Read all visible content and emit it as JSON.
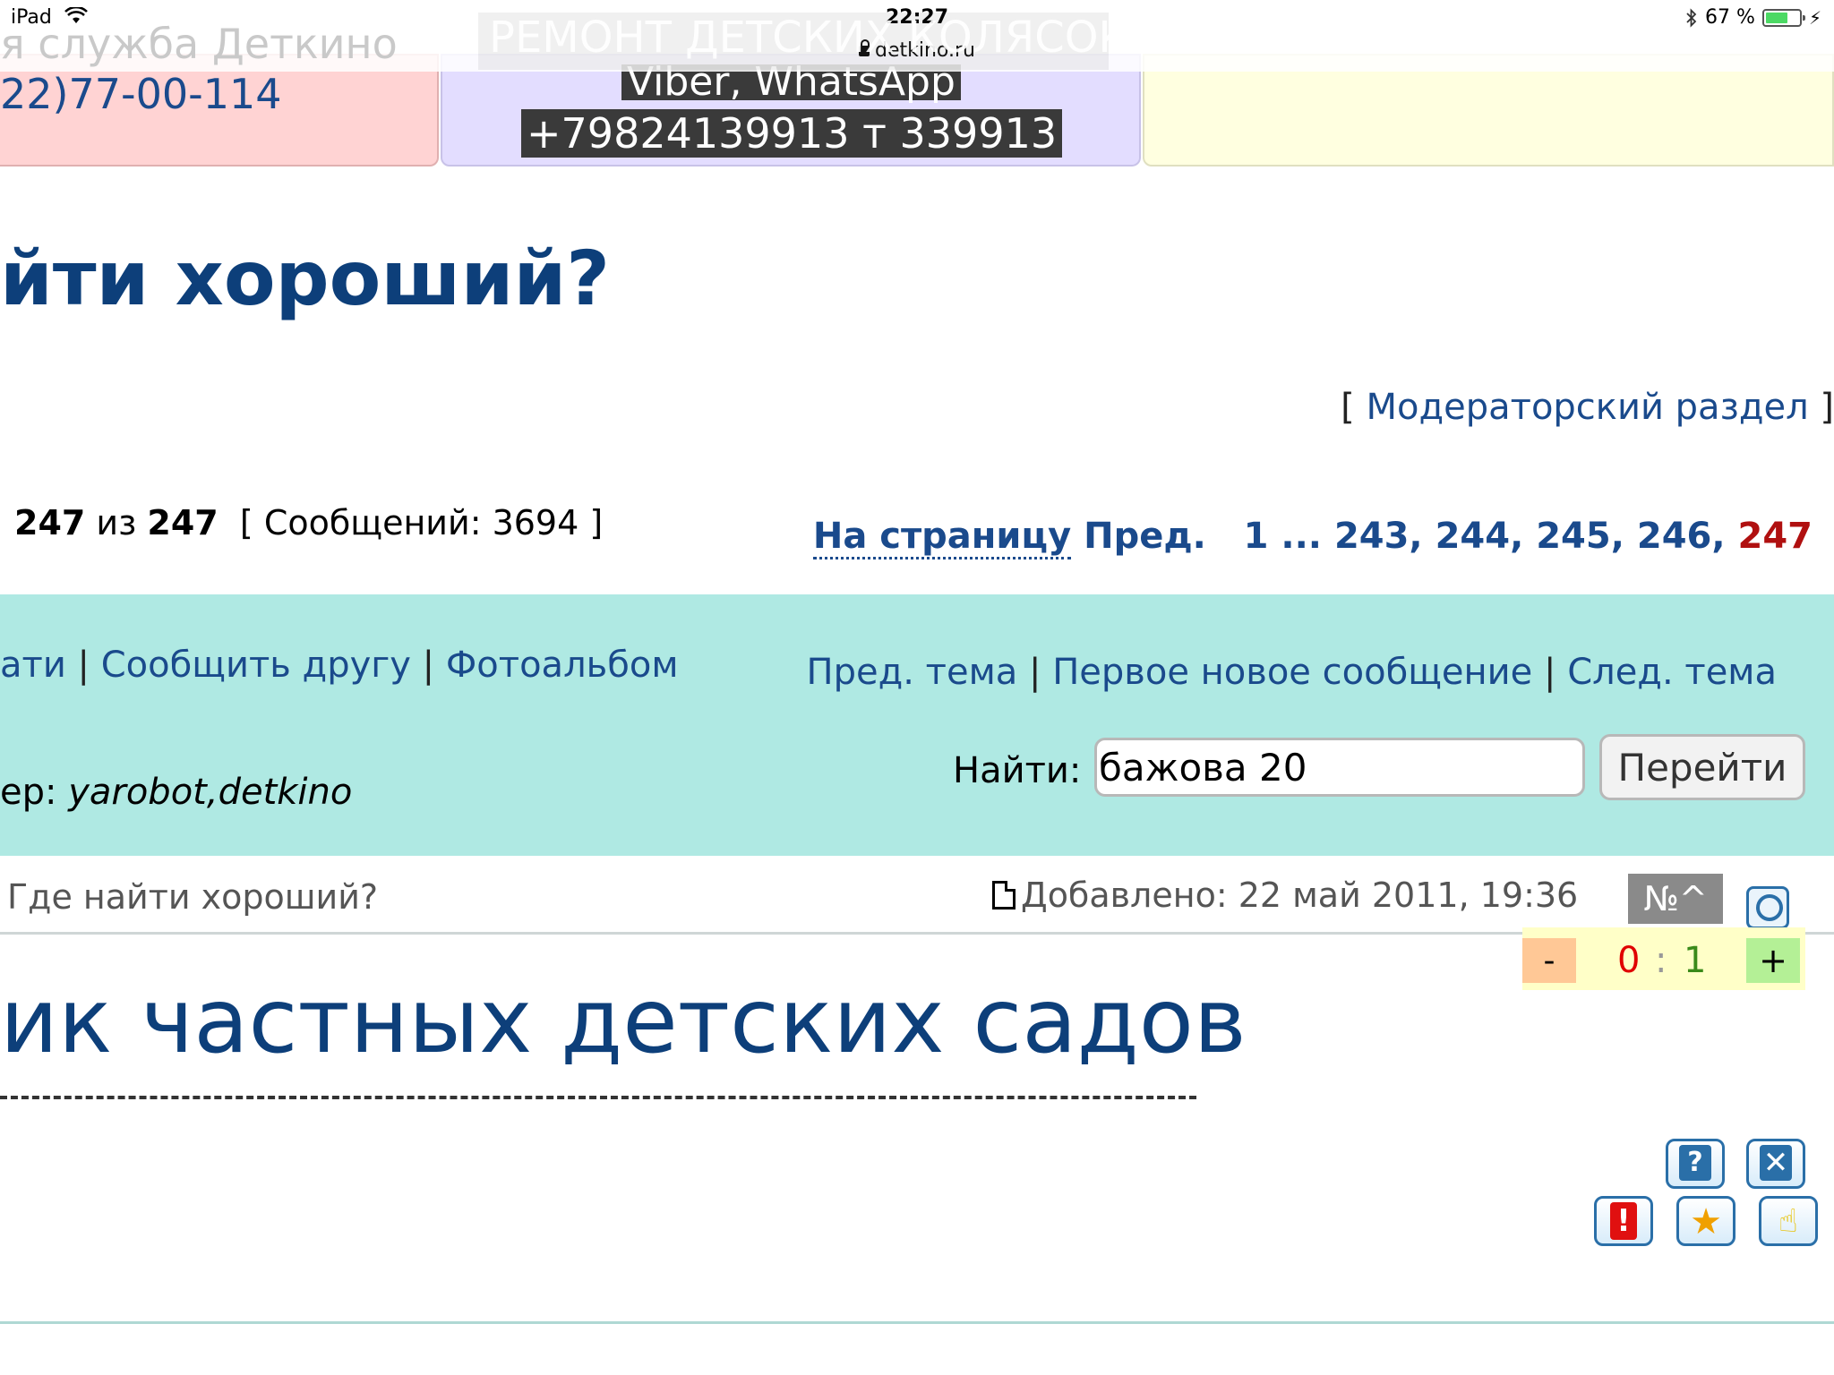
{
  "status_bar": {
    "device": "iPad",
    "time": "22:27",
    "battery": "67 %",
    "battery_level": 0.67,
    "charging_glyph": "⚡"
  },
  "browser": {
    "url": "detkino.ru"
  },
  "banners": {
    "ghost_service": "я служба Деткино",
    "ghost_repair": "РЕМОНТ ДЕТСКИХ КОЛЯСОК",
    "phone": "22)77-00-114",
    "viber": "Viber, WhatsApp",
    "tel": "+79824139913 т 339913"
  },
  "topic": {
    "title": "йти хороший?"
  },
  "moderator_section": {
    "open_bracket": "[",
    "label": "Модераторский раздел",
    "close_bracket": "]"
  },
  "page_info": {
    "current": "247",
    "of": "из",
    "total": "247",
    "messages_label": "[ Сообщений: 3694 ]"
  },
  "pagination": {
    "goto": "На страницу",
    "prev": "Пред.",
    "pages": [
      "1",
      "...",
      "243,",
      "244,",
      "245,",
      "246,"
    ],
    "current": "247"
  },
  "nav": {
    "left_prefix": "ати",
    "tell_friend": "Сообщить другу",
    "photo_album": "Фотоальбом",
    "prev_topic": "Пред. тема",
    "first_new": "Первое новое сообщение",
    "next_topic": "След. тема",
    "sep": "|"
  },
  "moderators": {
    "prefix": "ер:",
    "names": "yarobot,detkino"
  },
  "search": {
    "label": "Найти:",
    "value": "бажова 20",
    "button": "Перейти"
  },
  "post": {
    "subject": "Где найти хороший?",
    "added": "Добавлено: 22 май 2011, 19:36",
    "number": "№^",
    "title": "ик частных детских садов"
  },
  "rating": {
    "minus": "-",
    "negative": "0",
    "sep": ":",
    "positive": "1",
    "plus": "+"
  },
  "actions": {
    "help": "?",
    "close": "✕",
    "warn": "!",
    "star": "★",
    "thumb": "☝"
  }
}
